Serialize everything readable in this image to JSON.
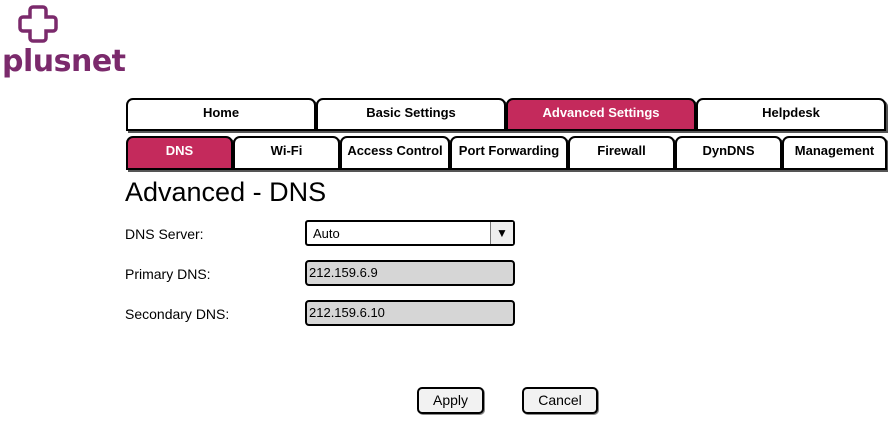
{
  "brand": {
    "name": "plusnet",
    "color": "#7b2a6c"
  },
  "main_tabs": [
    {
      "label": "Home"
    },
    {
      "label": "Basic Settings"
    },
    {
      "label": "Advanced Settings",
      "active": true
    },
    {
      "label": "Helpdesk"
    }
  ],
  "sub_tabs": [
    {
      "label": "DNS",
      "active": true
    },
    {
      "label": "Wi-Fi"
    },
    {
      "label": "Access Control"
    },
    {
      "label": "Port Forwarding"
    },
    {
      "label": "Firewall"
    },
    {
      "label": "DynDNS"
    },
    {
      "label": "Management"
    }
  ],
  "page": {
    "title": "Advanced - DNS"
  },
  "form": {
    "dns_server": {
      "label": "DNS Server:",
      "value": "Auto"
    },
    "primary_dns": {
      "label": "Primary DNS:",
      "value": "212.159.6.9"
    },
    "secondary_dns": {
      "label": "Secondary DNS:",
      "value": "212.159.6.10"
    }
  },
  "actions": {
    "apply": "Apply",
    "cancel": "Cancel"
  },
  "colors": {
    "accent": "#c42a5c",
    "readonly_bg": "#d6d6d6"
  }
}
